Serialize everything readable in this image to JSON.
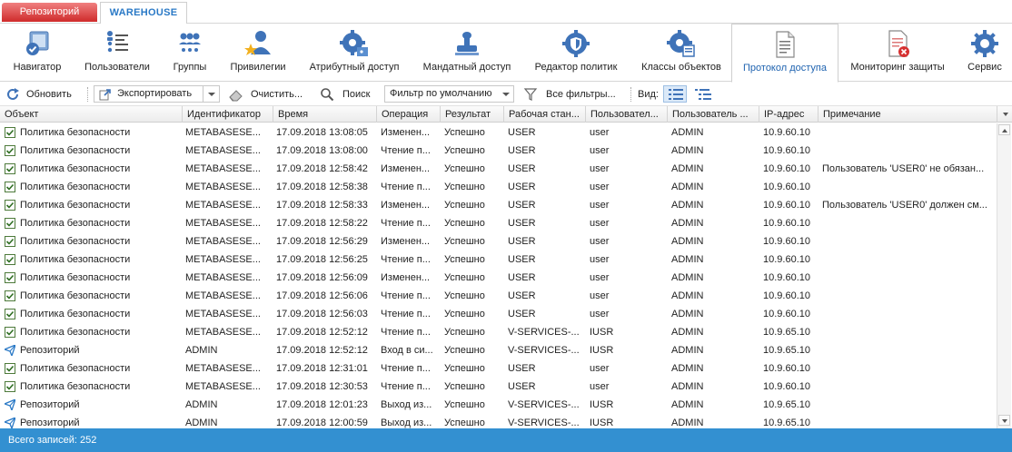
{
  "top_tabs": {
    "repository": "Репозиторий",
    "warehouse": "WAREHOUSE"
  },
  "ribbon": [
    {
      "label": "Навигатор",
      "icon": "navigator-icon"
    },
    {
      "label": "Пользователи",
      "icon": "users-list-icon"
    },
    {
      "label": "Группы",
      "icon": "groups-icon"
    },
    {
      "label": "Привилегии",
      "icon": "privileges-icon"
    },
    {
      "label": "Атрибутный доступ",
      "icon": "attribute-access-icon"
    },
    {
      "label": "Мандатный доступ",
      "icon": "mandatory-access-icon"
    },
    {
      "label": "Редактор политик",
      "icon": "policy-editor-icon"
    },
    {
      "label": "Классы объектов",
      "icon": "object-classes-icon"
    },
    {
      "label": "Протокол доступа",
      "icon": "access-log-icon",
      "active": true
    },
    {
      "label": "Мониторинг защиты",
      "icon": "security-monitoring-icon"
    },
    {
      "label": "Сервис",
      "icon": "service-icon"
    }
  ],
  "toolbar": {
    "refresh": "Обновить",
    "export": "Экспортировать",
    "clear": "Очистить...",
    "search": "Поиск",
    "filter_selected": "Фильтр по умолчанию",
    "all_filters": "Все фильтры...",
    "view_label": "Вид:"
  },
  "columns": [
    "Объект",
    "Идентификатор",
    "Время",
    "Операция",
    "Результат",
    "Рабочая стан...",
    "Пользовател...",
    "Пользователь ...",
    "IP-адрес",
    "Примечание"
  ],
  "rows": [
    {
      "icon": "policy",
      "cells": [
        "Политика безопасности",
        "METABASESE...",
        "17.09.2018 13:08:05",
        "Изменен...",
        "Успешно",
        "USER",
        "user",
        "ADMIN",
        "10.9.60.10",
        ""
      ]
    },
    {
      "icon": "policy",
      "cells": [
        "Политика безопасности",
        "METABASESE...",
        "17.09.2018 13:08:00",
        "Чтение п...",
        "Успешно",
        "USER",
        "user",
        "ADMIN",
        "10.9.60.10",
        ""
      ]
    },
    {
      "icon": "policy",
      "cells": [
        "Политика безопасности",
        "METABASESE...",
        "17.09.2018 12:58:42",
        "Изменен...",
        "Успешно",
        "USER",
        "user",
        "ADMIN",
        "10.9.60.10",
        "Пользователь 'USER0' не обязан..."
      ]
    },
    {
      "icon": "policy",
      "cells": [
        "Политика безопасности",
        "METABASESE...",
        "17.09.2018 12:58:38",
        "Чтение п...",
        "Успешно",
        "USER",
        "user",
        "ADMIN",
        "10.9.60.10",
        ""
      ]
    },
    {
      "icon": "policy",
      "cells": [
        "Политика безопасности",
        "METABASESE...",
        "17.09.2018 12:58:33",
        "Изменен...",
        "Успешно",
        "USER",
        "user",
        "ADMIN",
        "10.9.60.10",
        "Пользователь 'USER0' должен см..."
      ]
    },
    {
      "icon": "policy",
      "cells": [
        "Политика безопасности",
        "METABASESE...",
        "17.09.2018 12:58:22",
        "Чтение п...",
        "Успешно",
        "USER",
        "user",
        "ADMIN",
        "10.9.60.10",
        ""
      ]
    },
    {
      "icon": "policy",
      "cells": [
        "Политика безопасности",
        "METABASESE...",
        "17.09.2018 12:56:29",
        "Изменен...",
        "Успешно",
        "USER",
        "user",
        "ADMIN",
        "10.9.60.10",
        ""
      ]
    },
    {
      "icon": "policy",
      "cells": [
        "Политика безопасности",
        "METABASESE...",
        "17.09.2018 12:56:25",
        "Чтение п...",
        "Успешно",
        "USER",
        "user",
        "ADMIN",
        "10.9.60.10",
        ""
      ]
    },
    {
      "icon": "policy",
      "cells": [
        "Политика безопасности",
        "METABASESE...",
        "17.09.2018 12:56:09",
        "Изменен...",
        "Успешно",
        "USER",
        "user",
        "ADMIN",
        "10.9.60.10",
        ""
      ]
    },
    {
      "icon": "policy",
      "cells": [
        "Политика безопасности",
        "METABASESE...",
        "17.09.2018 12:56:06",
        "Чтение п...",
        "Успешно",
        "USER",
        "user",
        "ADMIN",
        "10.9.60.10",
        ""
      ]
    },
    {
      "icon": "policy",
      "cells": [
        "Политика безопасности",
        "METABASESE...",
        "17.09.2018 12:56:03",
        "Чтение п...",
        "Успешно",
        "USER",
        "user",
        "ADMIN",
        "10.9.60.10",
        ""
      ]
    },
    {
      "icon": "policy",
      "cells": [
        "Политика безопасности",
        "METABASESE...",
        "17.09.2018 12:52:12",
        "Чтение п...",
        "Успешно",
        "V-SERVICES-...",
        "IUSR",
        "ADMIN",
        "10.9.65.10",
        ""
      ]
    },
    {
      "icon": "repository",
      "cells": [
        "Репозиторий",
        "ADMIN",
        "17.09.2018 12:52:12",
        "Вход в си...",
        "Успешно",
        "V-SERVICES-...",
        "IUSR",
        "ADMIN",
        "10.9.65.10",
        ""
      ]
    },
    {
      "icon": "policy",
      "cells": [
        "Политика безопасности",
        "METABASESE...",
        "17.09.2018 12:31:01",
        "Чтение п...",
        "Успешно",
        "USER",
        "user",
        "ADMIN",
        "10.9.60.10",
        ""
      ]
    },
    {
      "icon": "policy",
      "cells": [
        "Политика безопасности",
        "METABASESE...",
        "17.09.2018 12:30:53",
        "Чтение п...",
        "Успешно",
        "USER",
        "user",
        "ADMIN",
        "10.9.60.10",
        ""
      ]
    },
    {
      "icon": "repository",
      "cells": [
        "Репозиторий",
        "ADMIN",
        "17.09.2018 12:01:23",
        "Выход из...",
        "Успешно",
        "V-SERVICES-...",
        "IUSR",
        "ADMIN",
        "10.9.65.10",
        ""
      ]
    },
    {
      "icon": "repository",
      "cells": [
        "Репозиторий",
        "ADMIN",
        "17.09.2018 12:00:59",
        "Выход из...",
        "Успешно",
        "V-SERVICES-...",
        "IUSR",
        "ADMIN",
        "10.9.65.10",
        ""
      ]
    }
  ],
  "status": {
    "total": "Всего записей: 252"
  },
  "colors": {
    "accent": "#2a79c6",
    "status_bar": "#3390d1",
    "repo_tab": "#cf2b2b"
  }
}
